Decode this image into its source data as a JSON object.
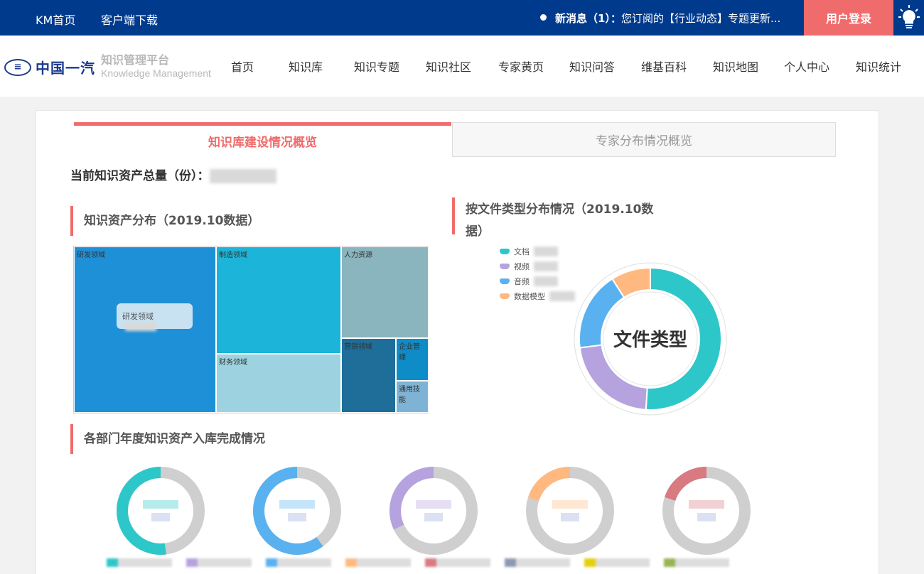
{
  "topbar": {
    "links": [
      "KM首页",
      "客户端下载"
    ],
    "news_label": "新消息（1）：",
    "news_text": "您订阅的【行业动态】专题更新...",
    "login_label": "用户登录"
  },
  "header": {
    "brand": "中国一汽",
    "platform_cn": "知识管理平台",
    "platform_en": "Knowledge Management",
    "menu": [
      "首页",
      "知识库",
      "知识专题",
      "知识社区",
      "专家黄页",
      "知识问答",
      "维基百科",
      "知识地图",
      "个人中心",
      "知识统计"
    ]
  },
  "tabs": {
    "active": "知识库建设情况概览",
    "inactive": "专家分布情况概览"
  },
  "summary": {
    "total_label": "当前知识资产总量（份）："
  },
  "sections": {
    "treemap_title": "知识资产分布（2019.10数据）",
    "donut_title_line1": "按文件类型分布情况（2019.10数",
    "donut_title_line2": "据）",
    "dept_title": "各部门年度知识资产入库完成情况"
  },
  "treemap": {
    "cells": [
      {
        "label": "研发领域",
        "color": "#1e90d8"
      },
      {
        "label": "制造领域",
        "color": "#1cb4d8"
      },
      {
        "label": "人力资源",
        "color": "#8ab4be"
      },
      {
        "label": "财务领域",
        "color": "#9dd3e0"
      },
      {
        "label": "营销领域",
        "color": "#1f6e9a"
      },
      {
        "label": "企业管理",
        "color": "#0e8cc8"
      },
      {
        "label": "通用技能",
        "color": "#7fb3d5"
      }
    ],
    "tooltip_label": "研发领域"
  },
  "chart_data": {
    "type": "pie",
    "center_label": "文件类型",
    "categories": [
      "文档",
      "视频",
      "音频",
      "数据模型"
    ],
    "colors": [
      "#2ec7c9",
      "#b6a2de",
      "#5ab1ef",
      "#ffb980"
    ],
    "values": [
      51,
      22,
      18,
      9
    ]
  },
  "dept_rings": [
    {
      "color": "#2ec7c9",
      "fraction": 0.52
    },
    {
      "color": "#5ab1ef",
      "fraction": 0.6
    },
    {
      "color": "#b6a2de",
      "fraction": 0.32
    },
    {
      "color": "#ffb980",
      "fraction": 0.2
    },
    {
      "color": "#d87a80",
      "fraction": 0.2
    }
  ],
  "bottom_legend_colors": [
    "#2ec7c9",
    "#b6a2de",
    "#5ab1ef",
    "#ffb980",
    "#d87a80",
    "#8d98b3",
    "#e5cf0d",
    "#97b552"
  ]
}
